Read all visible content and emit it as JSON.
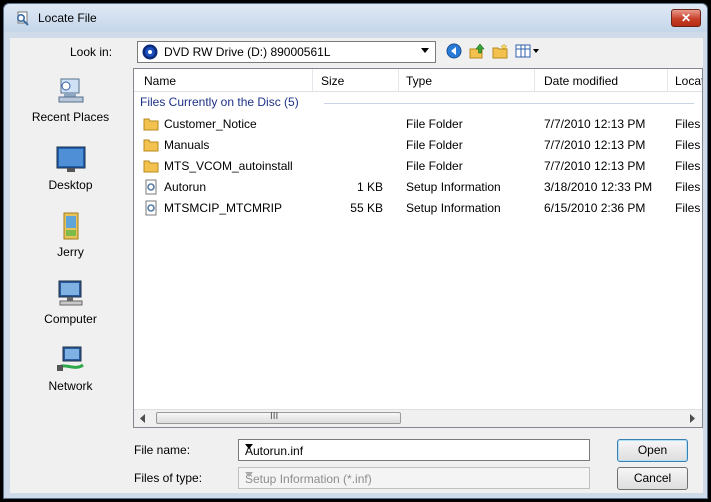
{
  "window": {
    "title": "Locate File",
    "close_label": "✕"
  },
  "toolbar": {
    "look_in_label": "Look in:",
    "look_in_value": "DVD RW Drive (D:) 89000561L"
  },
  "places": [
    {
      "label": "Recent Places",
      "icon": "recent-places-icon"
    },
    {
      "label": "Desktop",
      "icon": "desktop-icon"
    },
    {
      "label": "Jerry",
      "icon": "user-folder-icon"
    },
    {
      "label": "Computer",
      "icon": "computer-icon"
    },
    {
      "label": "Network",
      "icon": "network-icon"
    }
  ],
  "columns": {
    "name": "Name",
    "size": "Size",
    "type": "Type",
    "date": "Date modified",
    "location": "Locati"
  },
  "group_header": "Files Currently on the Disc (5)",
  "files": [
    {
      "name": "Customer_Notice",
      "size": "",
      "type": "File Folder",
      "date": "7/7/2010 12:13 PM",
      "location": "Files C",
      "icon": "folder-icon"
    },
    {
      "name": "Manuals",
      "size": "",
      "type": "File Folder",
      "date": "7/7/2010 12:13 PM",
      "location": "Files C",
      "icon": "folder-icon"
    },
    {
      "name": "MTS_VCOM_autoinstall",
      "size": "",
      "type": "File Folder",
      "date": "7/7/2010 12:13 PM",
      "location": "Files C",
      "icon": "folder-icon"
    },
    {
      "name": "Autorun",
      "size": "1 KB",
      "type": "Setup Information",
      "date": "3/18/2010 12:33 PM",
      "location": "Files C",
      "icon": "setup-info-icon"
    },
    {
      "name": "MTSMCIP_MTCMRIP",
      "size": "55 KB",
      "type": "Setup Information",
      "date": "6/15/2010 2:36 PM",
      "location": "Files C",
      "icon": "setup-info-icon"
    }
  ],
  "scrollbar": {
    "grip": "III"
  },
  "form": {
    "file_name_label": "File name:",
    "file_name_value": "Autorun.inf",
    "file_type_label": "Files of type:",
    "file_type_value": "Setup Information (*.inf)"
  },
  "buttons": {
    "open": "Open",
    "cancel": "Cancel"
  }
}
